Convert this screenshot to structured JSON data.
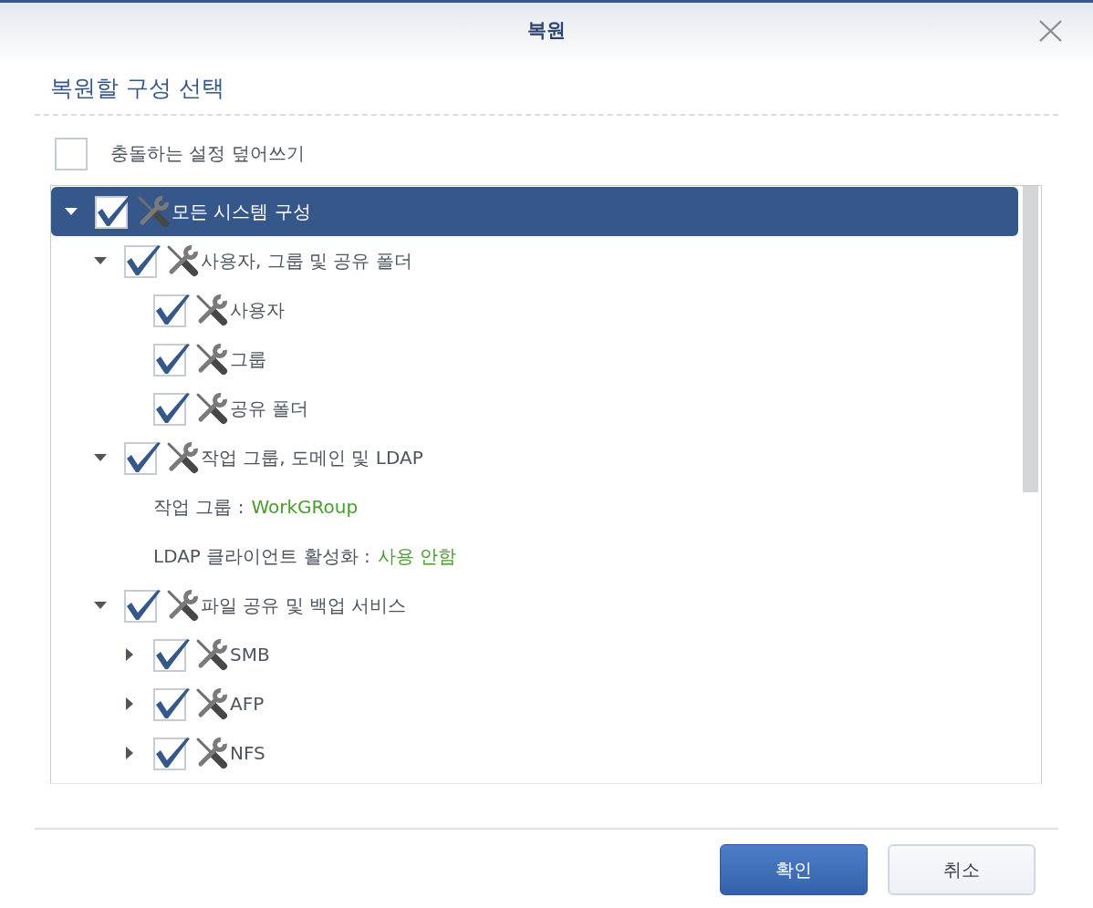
{
  "dialog": {
    "title": "복원"
  },
  "section_title": "복원할 구성 선택",
  "overwrite_option": {
    "label": "충돌하는 설정 덮어쓰기",
    "checked": false
  },
  "tree": {
    "items": [
      {
        "kind": "node",
        "label": "모든 시스템 구성",
        "checked": true,
        "expanded": true,
        "selected": true,
        "children": [
          {
            "kind": "node",
            "label": "사용자, 그룹 및 공유 폴더",
            "checked": true,
            "expanded": true,
            "selected": false,
            "children": [
              {
                "kind": "node",
                "label": "사용자",
                "checked": true,
                "selected": false
              },
              {
                "kind": "node",
                "label": "그룹",
                "checked": true,
                "selected": false
              },
              {
                "kind": "node",
                "label": "공유 폴더",
                "checked": true,
                "selected": false
              }
            ]
          },
          {
            "kind": "node",
            "label": "작업 그룹, 도메인 및 LDAP",
            "checked": true,
            "expanded": true,
            "selected": false,
            "children": [
              {
                "kind": "info",
                "label": "작업 그룹 :",
                "value": "WorkGRoup"
              },
              {
                "kind": "info",
                "label": "LDAP 클라이언트 활성화 :",
                "value": "사용 안함"
              }
            ]
          },
          {
            "kind": "node",
            "label": "파일 공유 및 백업 서비스",
            "checked": true,
            "expanded": true,
            "selected": false,
            "children": [
              {
                "kind": "node",
                "label": "SMB",
                "checked": true,
                "expanded": false,
                "selected": false
              },
              {
                "kind": "node",
                "label": "AFP",
                "checked": true,
                "expanded": false,
                "selected": false
              },
              {
                "kind": "node",
                "label": "NFS",
                "checked": true,
                "expanded": false,
                "selected": false
              }
            ]
          }
        ]
      }
    ]
  },
  "buttons": [
    {
      "kind": "primary",
      "label": "확인"
    },
    {
      "kind": "secondary",
      "label": "취소"
    }
  ]
}
